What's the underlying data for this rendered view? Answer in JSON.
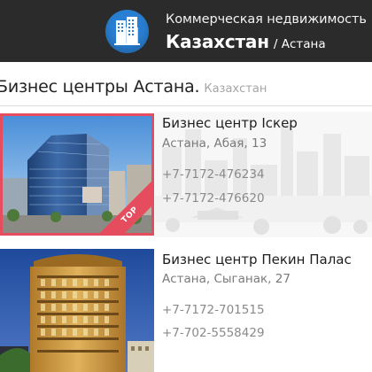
{
  "header": {
    "subtitle": "Коммерческая недвижимость",
    "country": "Казахстан",
    "city": "/ Астана"
  },
  "page": {
    "title": "Бизнес центры Астана.",
    "subtitle": "Казахстан"
  },
  "listings": [
    {
      "title": "Бизнес центр Іскер",
      "address": "Астана, Абая, 13",
      "phones": [
        "+7-7172-476234",
        "+7-7172-476620"
      ],
      "badge": "TOP"
    },
    {
      "title": "Бизнес центр Пекин Палас",
      "address": "Астана, Сыганак, 27",
      "phones": [
        "+7-7172-701515",
        "+7-702-5558429"
      ]
    }
  ],
  "colors": {
    "header_bg": "#2b2b2b",
    "accent_red": "#e54d5e",
    "logo_blue": "#2a7fd4"
  }
}
